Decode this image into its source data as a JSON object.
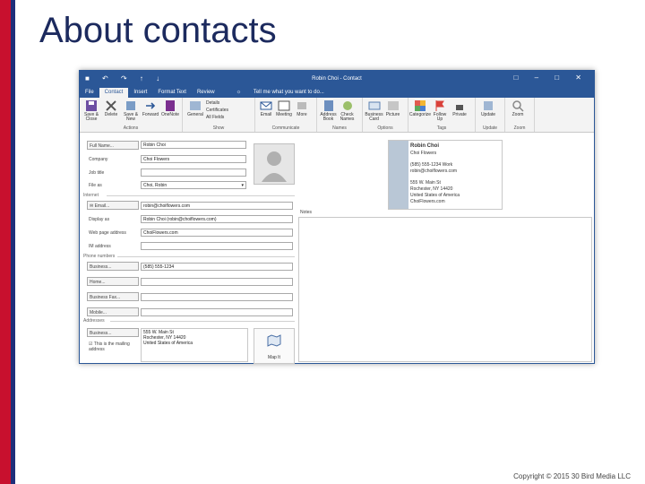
{
  "slide": {
    "title": "About contacts",
    "copyright": "Copyright © 2015 30 Bird Media LLC"
  },
  "window": {
    "title": "Robin Choi - Contact",
    "tabs": [
      "File",
      "Contact",
      "Insert",
      "Format Text",
      "Review"
    ],
    "active_tab": "Contact",
    "tell_me": "Tell me what you want to do..."
  },
  "ribbon": {
    "actions": {
      "name": "Actions",
      "buttons": [
        "Save & Close",
        "Delete",
        "Save & New",
        "Forward",
        "OneNote"
      ]
    },
    "show": {
      "name": "Show",
      "buttons": [
        "General"
      ],
      "small": [
        "Details",
        "Certificates",
        "All Fields"
      ]
    },
    "communicate": {
      "name": "Communicate",
      "buttons": [
        "Email",
        "Meeting",
        "More"
      ]
    },
    "names": {
      "name": "Names",
      "buttons": [
        "Address Book",
        "Check Names"
      ]
    },
    "options": {
      "name": "Options",
      "buttons": [
        "Business Card",
        "Picture"
      ]
    },
    "tags": {
      "name": "Tags",
      "buttons": [
        "Categorize",
        "Follow Up",
        "Private"
      ]
    },
    "update": {
      "name": "Update",
      "buttons": [
        "Update"
      ]
    },
    "zoom": {
      "name": "Zoom",
      "buttons": [
        "Zoom"
      ]
    }
  },
  "form": {
    "full_name_btn": "Full Name...",
    "full_name": "Robin Choi",
    "company_label": "Company",
    "company": "Choi Flowers",
    "job_title_label": "Job title",
    "job_title": "",
    "file_as_label": "File as",
    "file_as": "Choi, Robin",
    "internet_section": "Internet",
    "email_btn": "Email...",
    "email": "robin@choiflowers.com",
    "display_as_label": "Display as",
    "display_as": "Robin Choi (robin@choiflowers.com)",
    "web_label": "Web page address",
    "web": "ChoiFlowers.com",
    "im_label": "IM address",
    "im": "",
    "phone_section": "Phone numbers",
    "phones": [
      {
        "label": "Business...",
        "value": "(585) 555-1234"
      },
      {
        "label": "Home...",
        "value": ""
      },
      {
        "label": "Business Fax...",
        "value": ""
      },
      {
        "label": "Mobile...",
        "value": ""
      }
    ],
    "addresses_section": "Addresses",
    "address_btn": "Business...",
    "address_lines": [
      "555 W. Main St",
      "Rochester, NY 14420",
      "United States of America"
    ],
    "mailing_address": "This is the mailing address",
    "map_it": "Map It",
    "notes_label": "Notes"
  },
  "card": {
    "name": "Robin Choi",
    "company": "Choi Flowers",
    "phone": "(585) 555-1234 Work",
    "email": "robin@choiflowers.com",
    "street": "555 W. Main St",
    "city": "Rochester, NY 14420",
    "country": "United States of America",
    "web": "ChoiFlowers.com"
  }
}
